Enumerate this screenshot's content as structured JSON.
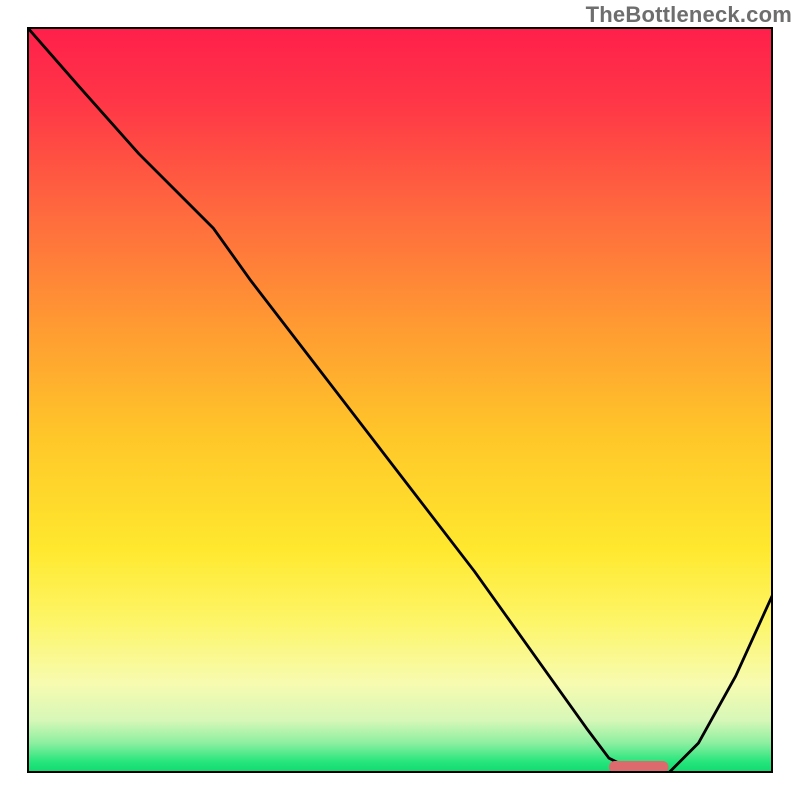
{
  "watermark": "TheBottleneck.com",
  "chart_data": {
    "type": "line",
    "title": "",
    "xlabel": "",
    "ylabel": "",
    "xlim": [
      0,
      100
    ],
    "ylim": [
      0,
      100
    ],
    "grid": false,
    "background_gradient": {
      "stops": [
        {
          "offset": 0.0,
          "color": "#ff1f4b"
        },
        {
          "offset": 0.1,
          "color": "#ff3647"
        },
        {
          "offset": 0.25,
          "color": "#ff6a3e"
        },
        {
          "offset": 0.4,
          "color": "#ff9a32"
        },
        {
          "offset": 0.55,
          "color": "#ffc729"
        },
        {
          "offset": 0.7,
          "color": "#ffe82e"
        },
        {
          "offset": 0.8,
          "color": "#fdf66a"
        },
        {
          "offset": 0.88,
          "color": "#f7fbb0"
        },
        {
          "offset": 0.93,
          "color": "#d6f7b8"
        },
        {
          "offset": 0.96,
          "color": "#8cefa0"
        },
        {
          "offset": 0.985,
          "color": "#26e57c"
        },
        {
          "offset": 1.0,
          "color": "#0fd96e"
        }
      ]
    },
    "series": [
      {
        "name": "bottleneck-curve",
        "x": [
          0,
          7,
          15,
          22,
          25,
          30,
          40,
          50,
          60,
          70,
          75,
          78,
          82,
          86,
          90,
          95,
          100
        ],
        "y": [
          100,
          92,
          83,
          76,
          73,
          66,
          53,
          40,
          27,
          13,
          6,
          2,
          0,
          0,
          4,
          13,
          24
        ]
      }
    ],
    "marker": {
      "shape": "rounded-bar",
      "x_range": [
        78,
        86
      ],
      "y": 0,
      "color": "#dd6a6d"
    }
  }
}
